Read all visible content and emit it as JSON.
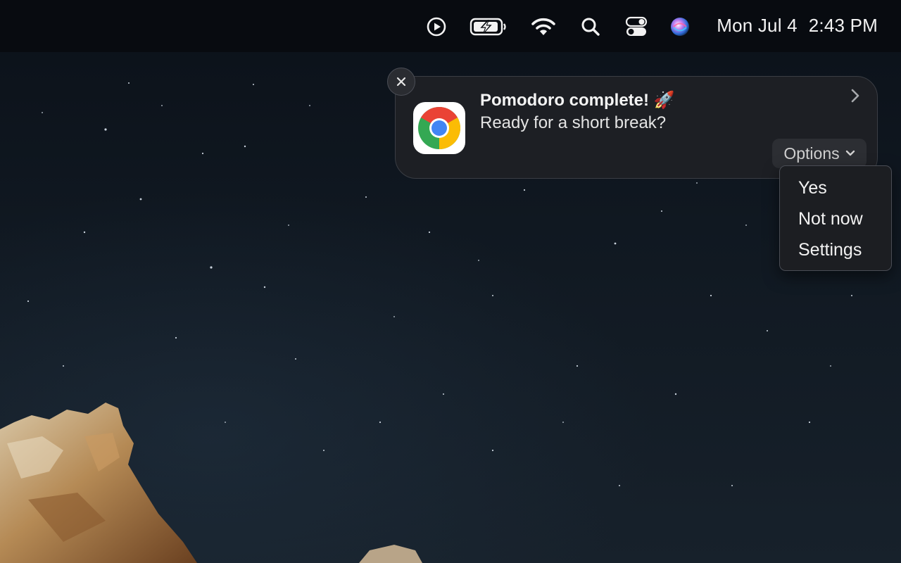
{
  "menubar": {
    "date": "Mon Jul 4",
    "time": "2:43 PM",
    "icons": [
      "now-playing-icon",
      "battery-charging-icon",
      "wifi-icon",
      "spotlight-search-icon",
      "control-center-icon",
      "siri-icon"
    ]
  },
  "notification": {
    "app_icon": "chrome-icon",
    "title": "Pomodoro complete! 🚀",
    "body": "Ready for a short break?",
    "options_label": "Options"
  },
  "options_menu": {
    "items": [
      "Yes",
      "Not now",
      "Settings"
    ]
  },
  "colors": {
    "notification_bg": "#1d1f24",
    "menubar_bg": "#080b10",
    "menu_bg": "#1c1e22"
  }
}
